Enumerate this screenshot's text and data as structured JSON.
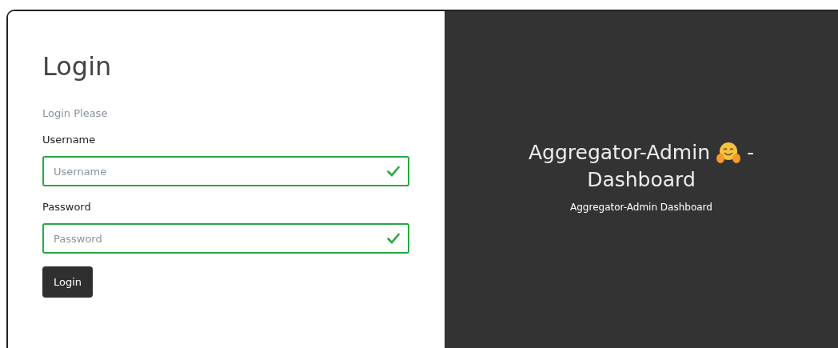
{
  "login_form": {
    "title": "Login",
    "subtitle": "Login Please",
    "fields": [
      {
        "label": "Username",
        "placeholder": "Username",
        "valid": true
      },
      {
        "label": "Password",
        "placeholder": "Password",
        "valid": true
      }
    ],
    "submit_button": "Login"
  },
  "banner": {
    "title_start": "Aggregator-Admin",
    "title_dash": "-",
    "title_end": "Dashboard",
    "subtitle": "Aggregator-Admin Dashboard"
  }
}
